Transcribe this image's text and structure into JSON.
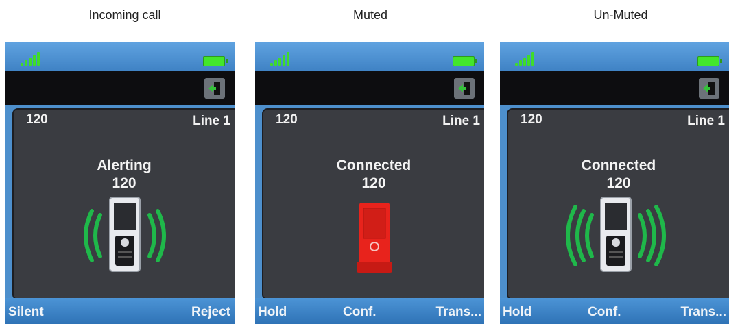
{
  "captions": {
    "incoming": "Incoming call",
    "muted": "Muted",
    "unmuted": "Un-Muted"
  },
  "phones": [
    {
      "number": "120",
      "line": "Line 1",
      "state": "Alerting",
      "caller": "120",
      "softkeys": [
        "Silent",
        "Reject"
      ],
      "icon": "ringing-handset-icon"
    },
    {
      "number": "120",
      "line": "Line 1",
      "state": "Connected",
      "caller": "120",
      "softkeys": [
        "Hold",
        "Conf.",
        "Trans..."
      ],
      "icon": "muted-handset-icon"
    },
    {
      "number": "120",
      "line": "Line 1",
      "state": "Connected",
      "caller": "120",
      "softkeys": [
        "Hold",
        "Conf.",
        "Trans..."
      ],
      "icon": "ringing-handset-icon"
    }
  ],
  "colors": {
    "signal": "#3fdc2a",
    "battery": "#43e62b",
    "waves": "#1fb84a",
    "muted": "#e8231c"
  }
}
